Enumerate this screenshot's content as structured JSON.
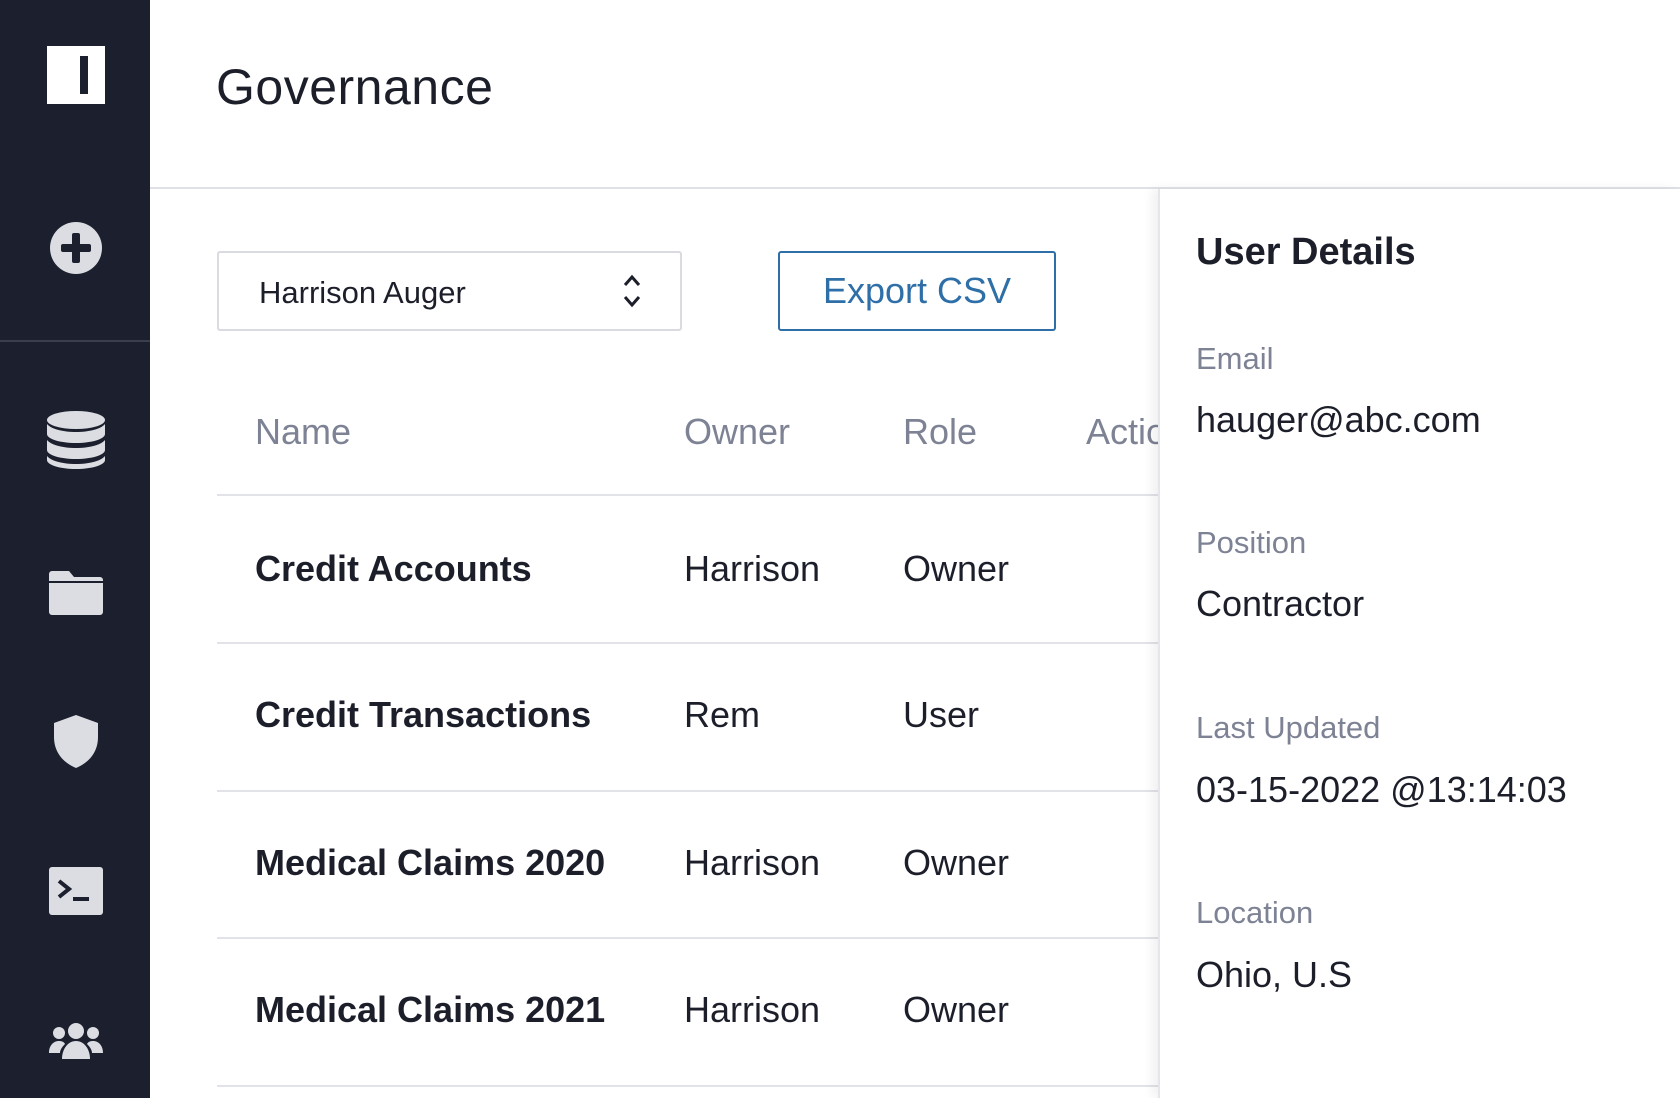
{
  "sidebar": {
    "items": [
      {
        "icon": "logo-icon"
      },
      {
        "icon": "plus-circle-icon"
      },
      {
        "icon": "database-icon"
      },
      {
        "icon": "folder-icon"
      },
      {
        "icon": "shield-icon"
      },
      {
        "icon": "terminal-icon"
      },
      {
        "icon": "users-icon"
      }
    ],
    "colors": {
      "background": "#1c1f2e",
      "icon": "#dcdde3"
    }
  },
  "header": {
    "title": "Governance"
  },
  "controls": {
    "user_select": {
      "value": "Harrison Auger"
    },
    "export_label": "Export CSV"
  },
  "table": {
    "columns": [
      "Name",
      "Owner",
      "Role",
      "Actions"
    ],
    "rows": [
      {
        "name": "Credit Accounts",
        "owner": "Harrison",
        "role": "Owner"
      },
      {
        "name": "Credit Transactions",
        "owner": "Rem",
        "role": "User"
      },
      {
        "name": "Medical Claims 2020",
        "owner": "Harrison",
        "role": "Owner"
      },
      {
        "name": "Medical Claims 2021",
        "owner": "Harrison",
        "role": "Owner"
      }
    ]
  },
  "details": {
    "title": "User Details",
    "fields": [
      {
        "label": "Email",
        "value": "hauger@abc.com"
      },
      {
        "label": "Position",
        "value": "Contractor"
      },
      {
        "label": "Last Updated",
        "value": "03-15-2022 @13:14:03"
      },
      {
        "label": "Location",
        "value": "Ohio, U.S"
      }
    ]
  },
  "colors": {
    "accent": "#2f6fa8",
    "muted_text": "#7d8294"
  }
}
